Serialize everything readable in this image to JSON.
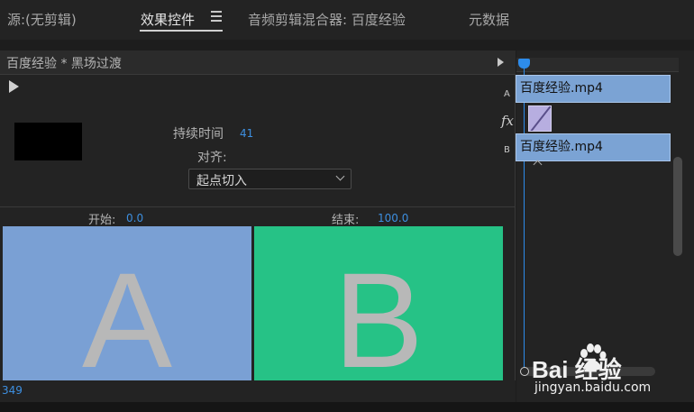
{
  "tabs": [
    {
      "label": "源:(无剪辑)",
      "active": false
    },
    {
      "label": "效果控件",
      "active": true
    },
    {
      "label": "音频剪辑混合器: 百度经验",
      "active": false
    },
    {
      "label": "元数据",
      "active": false
    }
  ],
  "panel": {
    "title": "百度经验 * 黑场过渡",
    "duration_label": "持续时间",
    "duration_value": "41",
    "align_label": "对齐:",
    "align_selected": "起点切入",
    "start_label": "开始:",
    "start_value": "0.0",
    "end_label": "结束:",
    "end_value": "100.0",
    "preview_a_letter": "A",
    "preview_b_letter": "B",
    "timecode": "349"
  },
  "timeline": {
    "track_a_label": "A",
    "track_b_label": "B",
    "fx_label": "fx",
    "clip_a_name": "百度经验.mp4",
    "clip_b_name": "百度经验.mp4"
  },
  "watermark": {
    "logo_text": "Bai  经验",
    "url": "jingyan.baidu.com"
  },
  "colors": {
    "accent": "#3d8fe0",
    "preview_a": "#7aa0d4",
    "preview_b": "#26c286",
    "clip": "#7ba3d4",
    "transition": "#b7aee0"
  }
}
